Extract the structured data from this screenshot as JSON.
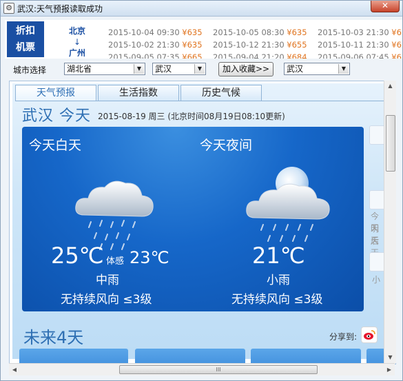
{
  "window": {
    "title": "武汉:天气预报读取成功",
    "close_glyph": "✕",
    "app_icon_glyph": "⚙"
  },
  "ticker": {
    "badge_line1": "折扣",
    "badge_line2": "机票",
    "route_from": "北京",
    "route_arrow": "↓",
    "route_to": "广州",
    "fares": [
      [
        {
          "time": "2015-10-04 09:30",
          "price": "¥635"
        },
        {
          "time": "2015-10-05 08:30",
          "price": "¥635"
        },
        {
          "time": "2015-10-03 21:30",
          "price": "¥6"
        }
      ],
      [
        {
          "time": "2015-10-02 21:30",
          "price": "¥635"
        },
        {
          "time": "2015-10-12 21:30",
          "price": "¥655"
        },
        {
          "time": "2015-10-11 21:30",
          "price": "¥6"
        }
      ],
      [
        {
          "time": "2015-09-05 07:35",
          "price": "¥665"
        },
        {
          "time": "2015-09-04 21:20",
          "price": "¥684"
        },
        {
          "time": "2015-09-06 07:45",
          "price": "¥6"
        }
      ]
    ]
  },
  "city_bar": {
    "label": "城市选择",
    "province": "湖北省",
    "city": "武汉",
    "collect_button": "加入收藏>>",
    "favorite": "武汉",
    "caret": "▼"
  },
  "tabs": [
    {
      "label": "天气预报",
      "active": true
    },
    {
      "label": "生活指数",
      "active": false
    },
    {
      "label": "历史气候",
      "active": false
    }
  ],
  "today": {
    "heading": "武汉 今天",
    "date": "2015-08-19 周三 (北京时间08月19日08:10更新)",
    "day": {
      "title": "今天白天",
      "temp": "25℃",
      "feel_label": "体感",
      "feel_temp": "23℃",
      "condition": "中雨",
      "wind": "无持续风向 ≤3级"
    },
    "night": {
      "title": "今天夜间",
      "temp": "21℃",
      "condition": "小雨",
      "wind": "无持续风向 ≤3级"
    }
  },
  "side": {
    "lines": [
      "今天",
      "明天",
      "后天"
    ],
    "bottom_char": "小"
  },
  "future": {
    "title": "未来4天",
    "share_label": "分享到:"
  },
  "scroll": {
    "up": "▲",
    "down": "▼",
    "left": "◀",
    "right": "▶",
    "grip": "III"
  }
}
